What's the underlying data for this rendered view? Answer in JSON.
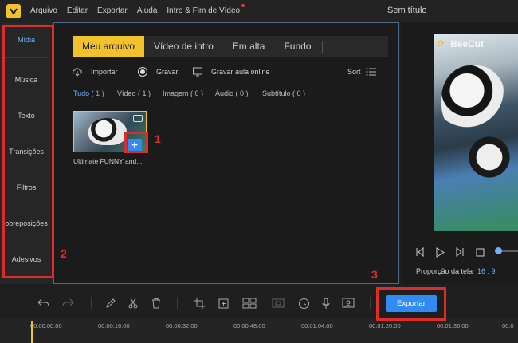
{
  "menubar": {
    "items": [
      "Arquivo",
      "Editar",
      "Exportar",
      "Ajuda",
      "Intro & Fim de Vídeo"
    ],
    "window_title": "Sem título"
  },
  "sidebar": {
    "items": [
      "Mídia",
      "Música",
      "Texto",
      "Transições",
      "Filtros",
      "obreposições",
      "Adesivos"
    ],
    "active": "Mídia"
  },
  "media": {
    "tabs": [
      "Meu arquivo",
      "Vídeo de intro",
      "Em alta",
      "Fundo"
    ],
    "active_tab": "Meu arquivo",
    "actions": {
      "import": "Importar",
      "record": "Gravar",
      "record_class": "Gravar aula online",
      "sort": "Sort"
    },
    "filters": [
      "Tudo ( 1 )",
      "Vídeo ( 1 )",
      "Imagem ( 0 )",
      "Áudio ( 0 )",
      "Subtítulo ( 0 )"
    ],
    "thumbnail": {
      "label": "Ultimate FUNNY and...",
      "add_symbol": "+"
    }
  },
  "preview": {
    "brand": "BeeCut",
    "ratio_label": "Proporção da tela",
    "ratio_value": "16 : 9"
  },
  "toolbar": {
    "export_label": "Exportar"
  },
  "timeline": {
    "ticks": [
      "00:00:00.00",
      "00:00:16.00",
      "00:00:32.00",
      "00:00:48.00",
      "00:01:04.00",
      "00:01:20.00",
      "00:01:36.00",
      "00:0"
    ]
  },
  "annotations": {
    "labels": [
      "1",
      "2",
      "3"
    ],
    "color": "#e02b2b"
  },
  "colors": {
    "accent": "#f2c22c",
    "primary_button": "#2f8cf5",
    "active_text": "#6db1ff"
  }
}
